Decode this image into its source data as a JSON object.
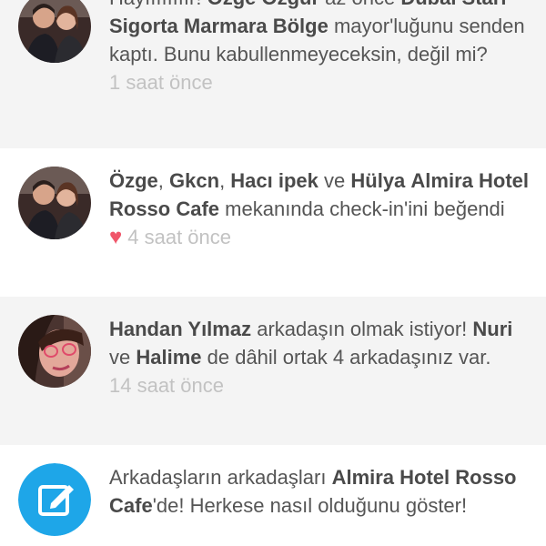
{
  "feed": {
    "items": [
      {
        "avatar_icon": "couple-photo-avatar",
        "segments": [
          {
            "t": "Hayıııııııır! ",
            "b": false
          },
          {
            "t": "Özge Özgür",
            "b": true
          },
          {
            "t": " az önce ",
            "b": false
          },
          {
            "t": "Dubai Starr Sigorta Marmara Bölge",
            "b": true
          },
          {
            "t": " mayor'luğunu senden kaptı. Bunu kabullenmeyeceksin, değil mi?",
            "b": false
          }
        ],
        "time": "1 saat önce"
      },
      {
        "avatar_icon": "couple-photo-avatar",
        "segments": [
          {
            "t": "Özge",
            "b": true
          },
          {
            "t": ", ",
            "b": false
          },
          {
            "t": "Gkcn",
            "b": true
          },
          {
            "t": ", ",
            "b": false
          },
          {
            "t": "Hacı ipek",
            "b": true
          },
          {
            "t": " ve ",
            "b": false
          },
          {
            "t": "Hülya",
            "b": true
          },
          {
            "t": " ",
            "b": false
          },
          {
            "t": "Almira Hotel  Rosso Cafe",
            "b": true
          },
          {
            "t": " mekanında check-in'ini beğendi",
            "b": false
          }
        ],
        "liked": true,
        "time": "4 saat önce"
      },
      {
        "avatar_icon": "woman-photo-avatar",
        "segments": [
          {
            "t": "Handan Yılmaz",
            "b": true
          },
          {
            "t": " arkadaşın olmak istiyor! ",
            "b": false
          },
          {
            "t": "Nuri",
            "b": true
          },
          {
            "t": " ve ",
            "b": false
          },
          {
            "t": "Halime",
            "b": true
          },
          {
            "t": " de dâhil ortak 4 arkadaşınız var.",
            "b": false
          }
        ],
        "time": "14 saat önce"
      },
      {
        "avatar_icon": "edit-icon",
        "segments": [
          {
            "t": "Arkadaşların arkadaşları ",
            "b": false
          },
          {
            "t": "Almira Hotel Rosso Cafe",
            "b": true
          },
          {
            "t": "'de! Herkese nasıl olduğunu göster!",
            "b": false
          }
        ],
        "time": ""
      }
    ]
  },
  "colors": {
    "row_alt_bg": "#f4f4f4",
    "heart": "#f0566a",
    "app_icon_bg": "#1ea6e8",
    "time_text": "#c2c2c2"
  }
}
